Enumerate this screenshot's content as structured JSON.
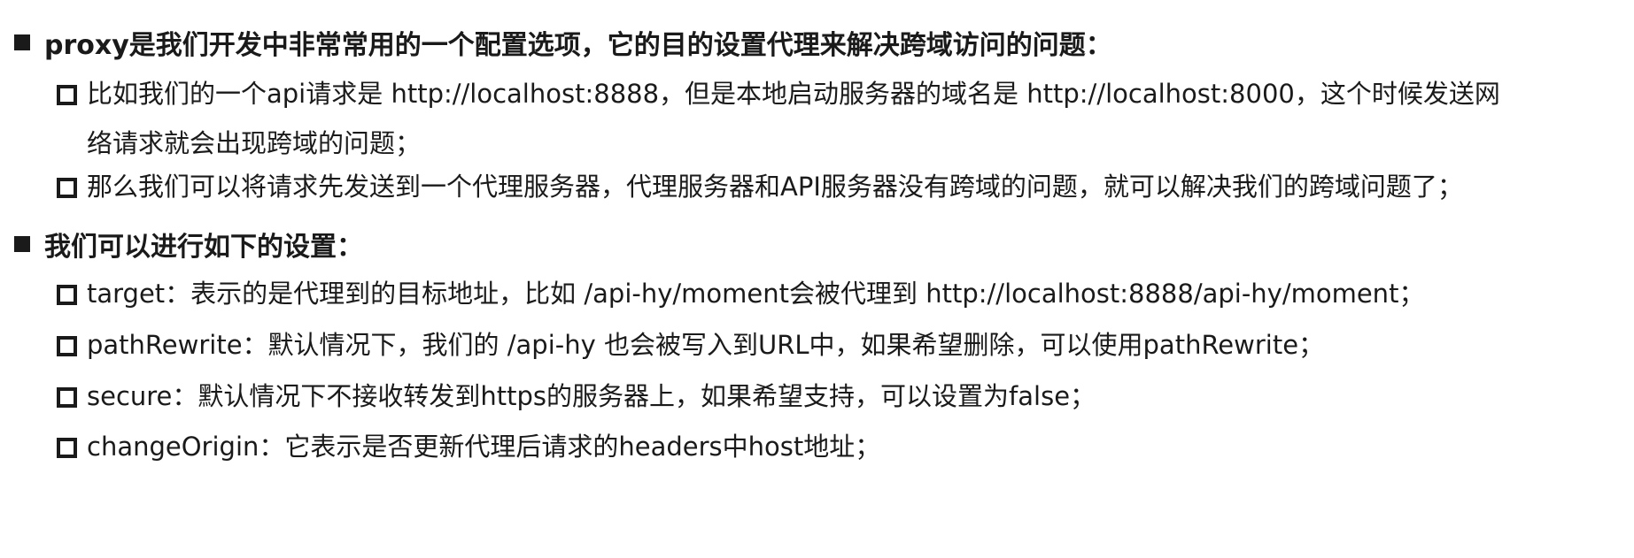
{
  "section1": {
    "heading": "proxy是我们开发中非常常用的一个配置选项，它的目的设置代理来解决跨域访问的问题：",
    "items": [
      {
        "line1": "比如我们的一个api请求是 http://localhost:8888，但是本地启动服务器的域名是 http://localhost:8000，这个时候发送网",
        "line2": "络请求就会出现跨域的问题；"
      },
      {
        "line1": "那么我们可以将请求先发送到一个代理服务器，代理服务器和API服务器没有跨域的问题，就可以解决我们的跨域问题了；"
      }
    ]
  },
  "section2": {
    "heading": "我们可以进行如下的设置：",
    "items": [
      {
        "line1": "target：表示的是代理到的目标地址，比如 /api-hy/moment会被代理到 http://localhost:8888/api-hy/moment；"
      },
      {
        "line1": "pathRewrite：默认情况下，我们的 /api-hy 也会被写入到URL中，如果希望删除，可以使用pathRewrite；"
      },
      {
        "line1": "secure：默认情况下不接收转发到https的服务器上，如果希望支持，可以设置为false；"
      },
      {
        "line1": "changeOrigin：它表示是否更新代理后请求的headers中host地址；"
      }
    ]
  }
}
